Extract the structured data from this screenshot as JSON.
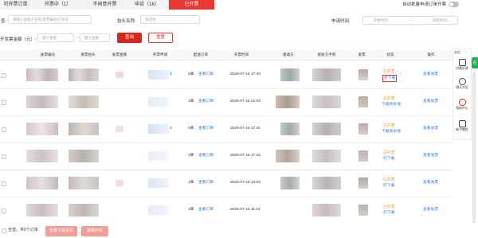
{
  "tabs": [
    {
      "label": "可开票订单",
      "w": 0
    },
    {
      "label": "开票中（1）"
    },
    {
      "label": "不同意开票"
    },
    {
      "label": "申诉（16）"
    },
    {
      "label": "已开票"
    }
  ],
  "auto_apply": {
    "label": "自动批量申请订单开票"
  },
  "filters": {
    "search_label": "查:",
    "search_placeholder": "请输入接收方名称/发票编号/订单号",
    "title_label": "抬头名称:",
    "title_placeholder": "请选择",
    "time_label": "申请时间:",
    "start_placeholder": "开始时间",
    "dash": "—",
    "end_placeholder": "结束时间",
    "amount_label": "开发票金额（元）:",
    "min_placeholder": "最小金额",
    "amount_dash": "—",
    "max_placeholder": "最大金额",
    "search_button": "查询",
    "reset_button": "重置"
  },
  "table": {
    "headers": [
      "发票编号",
      "发票抬头",
      "发票金额",
      "开票申请",
      "配送订单",
      "开票时间",
      "接收方",
      "接收方手机",
      "发票",
      "状态",
      "操作"
    ],
    "rows": [
      {
        "orders": "5单",
        "view": "查看订单",
        "time": "2025-07-16 17:40",
        "status": "已开票",
        "action2": "打下载",
        "op": "查看发票",
        "highlight": true,
        "extra": "$"
      },
      {
        "orders": "1单",
        "view": "查看订单",
        "time": "2025-07-16 21:03",
        "status": "已开票",
        "action2": "下载到本地",
        "op": "查看发票",
        "highlight": false,
        "extra": ""
      },
      {
        "orders": "5单",
        "view": "查看订单",
        "time": "2025-07-16 17:40",
        "status": "已开票",
        "action2": "下载到本地",
        "op": "查看发票",
        "highlight": false,
        "extra": "$"
      },
      {
        "orders": "1单",
        "view": "查看订单",
        "time": "2025-07-16 17:15",
        "status": "已开票",
        "action2": "打下载",
        "op": "查看发票",
        "highlight": false,
        "extra": ""
      },
      {
        "orders": "1单",
        "view": "查看订单",
        "time": "2025-07-16 13:02",
        "status": "已开票",
        "action2": "打下载",
        "op": "查看发票",
        "highlight": false,
        "extra": ""
      },
      {
        "orders": "1单",
        "view": "查看订单",
        "time": "2025-07-16 11:43",
        "status": "已开票",
        "action2": "打下载",
        "op": "查看发票",
        "highlight": false,
        "extra": ""
      }
    ]
  },
  "bottom": {
    "select_all": "全选，共0个订单",
    "batch_download": "批量下载发票",
    "batch_reapply": "批量申诉"
  },
  "right_panel": {
    "header": "收起",
    "green_tab": "在",
    "items": [
      "问题反馈",
      "聊天对话",
      "帮助中心",
      "新手教程"
    ]
  }
}
